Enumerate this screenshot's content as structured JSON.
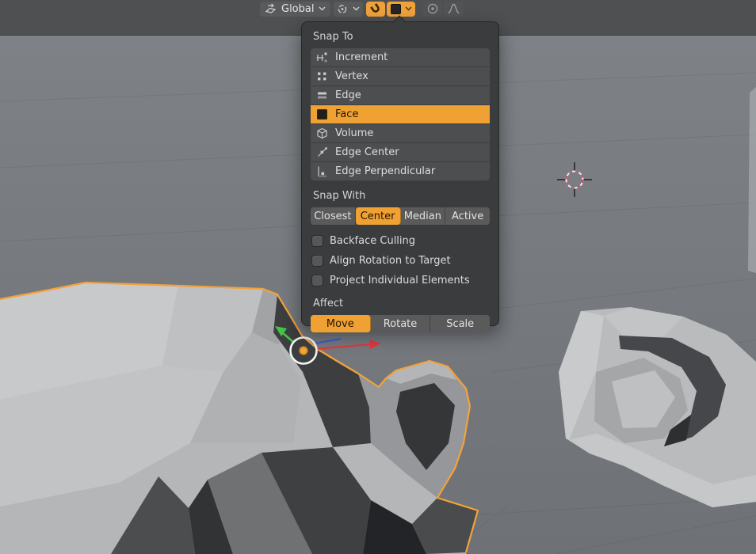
{
  "colors": {
    "accent_orange": "#f0a133",
    "header_bg": "#4f5051",
    "panel_bg": "#3b3c3d",
    "row_bg": "#4d4e4f",
    "viewport_top": "#7e8286",
    "viewport_bottom": "#6e7277",
    "selection_outline": "#f3a23a",
    "axis_x_red": "#e0393f",
    "axis_y_green": "#44c544",
    "axis_z_blue": "#3b5bd6"
  },
  "toolbar": {
    "orientation": {
      "label": "Global",
      "icon": "transform-orientation-icon"
    },
    "pivot": {
      "icon": "pivot-point-icon"
    },
    "snap_toggle": {
      "icon": "magnet-icon",
      "active": true
    },
    "snap_dropdown": {
      "icon": "snap-face-icon",
      "active": true
    },
    "proportional": {
      "icon": "proportional-editing-icon"
    },
    "falloff": {
      "icon": "falloff-curve-icon"
    }
  },
  "popover": {
    "snap_to": {
      "label": "Snap To",
      "items": [
        {
          "label": "Increment",
          "icon": "increment-icon",
          "active": false
        },
        {
          "label": "Vertex",
          "icon": "vertex-icon",
          "active": false
        },
        {
          "label": "Edge",
          "icon": "edge-icon",
          "active": false
        },
        {
          "label": "Face",
          "icon": "face-icon",
          "active": true
        },
        {
          "label": "Volume",
          "icon": "volume-icon",
          "active": false
        },
        {
          "label": "Edge Center",
          "icon": "edge-center-icon",
          "active": false
        },
        {
          "label": "Edge Perpendicular",
          "icon": "edge-perpendicular-icon",
          "active": false
        }
      ]
    },
    "snap_with": {
      "label": "Snap With",
      "options": [
        {
          "label": "Closest",
          "active": false
        },
        {
          "label": "Center",
          "active": true
        },
        {
          "label": "Median",
          "active": false
        },
        {
          "label": "Active",
          "active": false
        }
      ]
    },
    "checkboxes": [
      {
        "label": "Backface Culling",
        "checked": false
      },
      {
        "label": "Align Rotation to Target",
        "checked": false
      },
      {
        "label": "Project Individual Elements",
        "checked": false
      }
    ],
    "affect": {
      "label": "Affect",
      "options": [
        {
          "label": "Move",
          "active": true
        },
        {
          "label": "Rotate",
          "active": false
        },
        {
          "label": "Scale",
          "active": false
        }
      ]
    }
  }
}
